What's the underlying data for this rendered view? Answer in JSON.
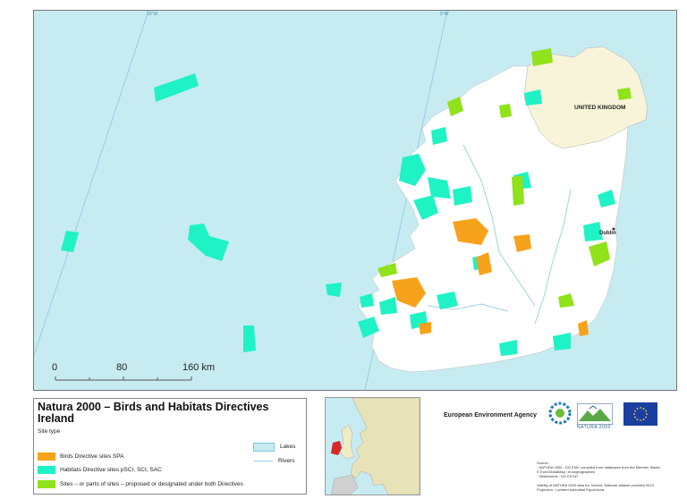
{
  "map": {
    "country_label": "UNITED KINGDOM",
    "city_label": "Dublin",
    "coord_ticks": [
      "10°W",
      "5°W"
    ],
    "colors": {
      "sea": "#c6ecf2",
      "land": "#ffffff",
      "uk_land": "#f7f4d9",
      "spa": "#f7a21b",
      "sci": "#1ff2c4",
      "both": "#90e21b",
      "river": "#9ed3e4"
    }
  },
  "scale_bar": {
    "labels": [
      "0",
      "80",
      "160 km"
    ]
  },
  "legend": {
    "title": "Natura 2000 – Birds and Habitats Directives",
    "subtitle": "Ireland",
    "section_label": "Site type",
    "items": [
      {
        "label": "Birds Directive sites SPA",
        "color": "#f7a21b"
      },
      {
        "label": "Habitats Directive sites pSCI, SCI, SAC",
        "color": "#1ff2c4"
      },
      {
        "label": "Sites – or parts of sites – proposed or designated under both Directives",
        "color": "#90e21b"
      }
    ],
    "lakes_label": "Lakes",
    "rivers_label": "Rivers"
  },
  "footer": {
    "agency_name": "European Environment Agency",
    "natura_caption": "NATURA 2000",
    "source_lines": [
      "Source :",
      "- NATURA 2000 - DG ENV, compiled from databases from the Member States",
      "  © EuroGlobalMap / eurogeographics",
      "- Settlements : DG ESTAT",
      "",
      "Validity of NATURA 2000 data for: Ireland. National dataset provided 2013.",
      "Projection : Lambert Azimuthal Equal Area."
    ]
  }
}
